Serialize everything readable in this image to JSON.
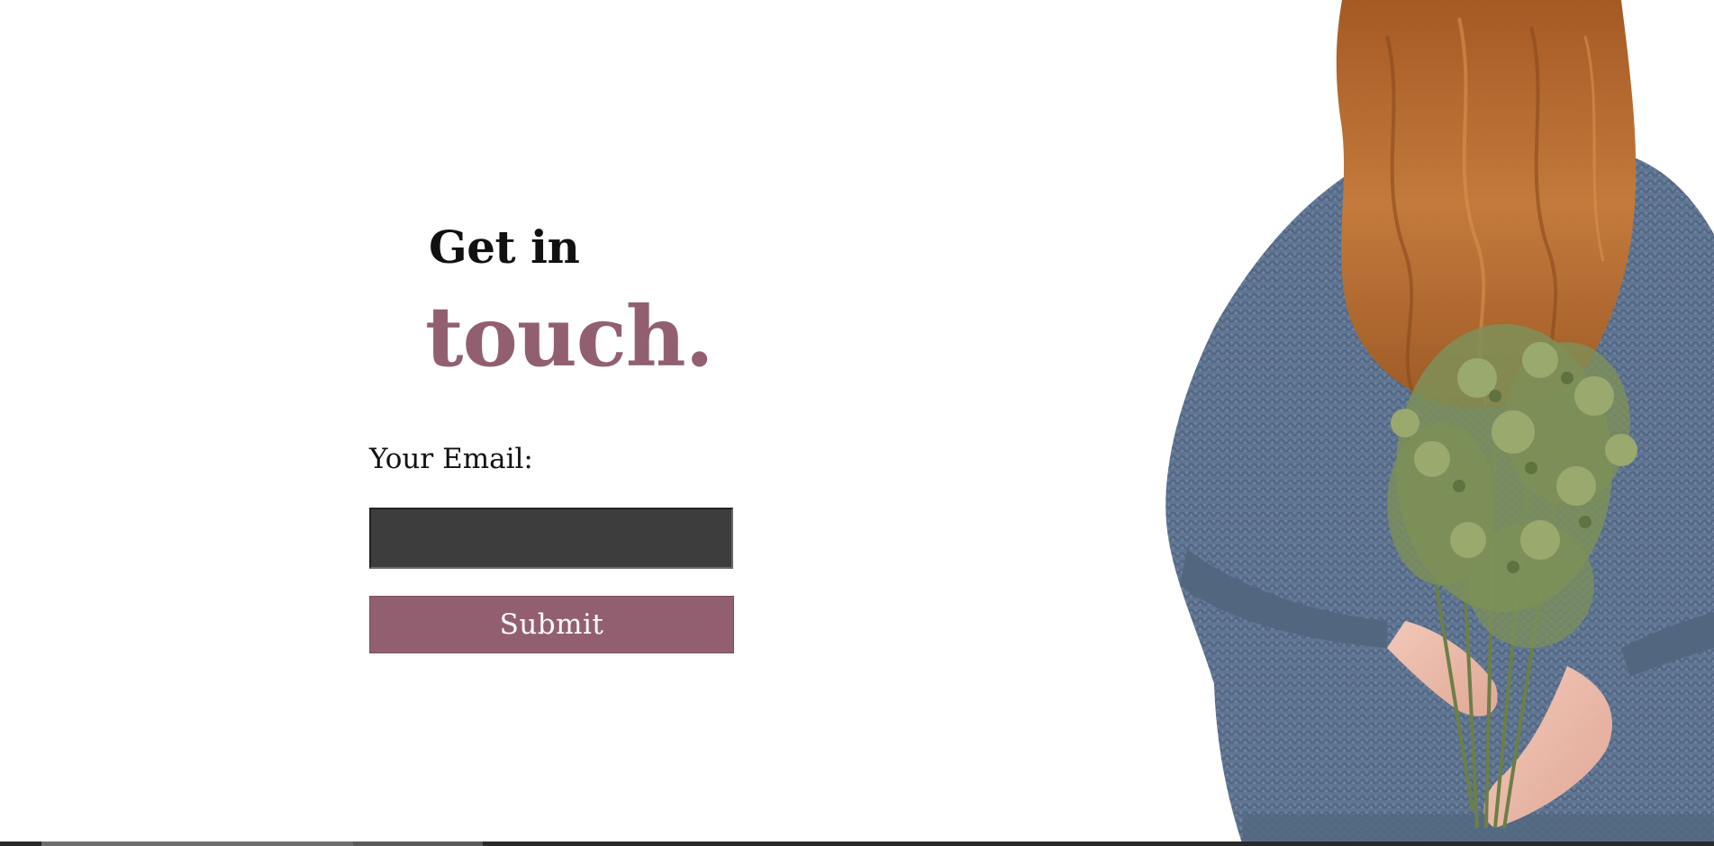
{
  "heading": {
    "line1": "Get in",
    "line2": "touch."
  },
  "form": {
    "email_label": "Your Email:",
    "email_value": "",
    "email_placeholder": "",
    "submit_label": "Submit"
  },
  "colors": {
    "accent": "#925f71",
    "input_bg": "#3d3d3d",
    "sweater": "#5f7592",
    "hair": "#b0662e",
    "bouquet": "#7e9058"
  },
  "image": {
    "subject": "woman-with-bouquet-photo"
  }
}
